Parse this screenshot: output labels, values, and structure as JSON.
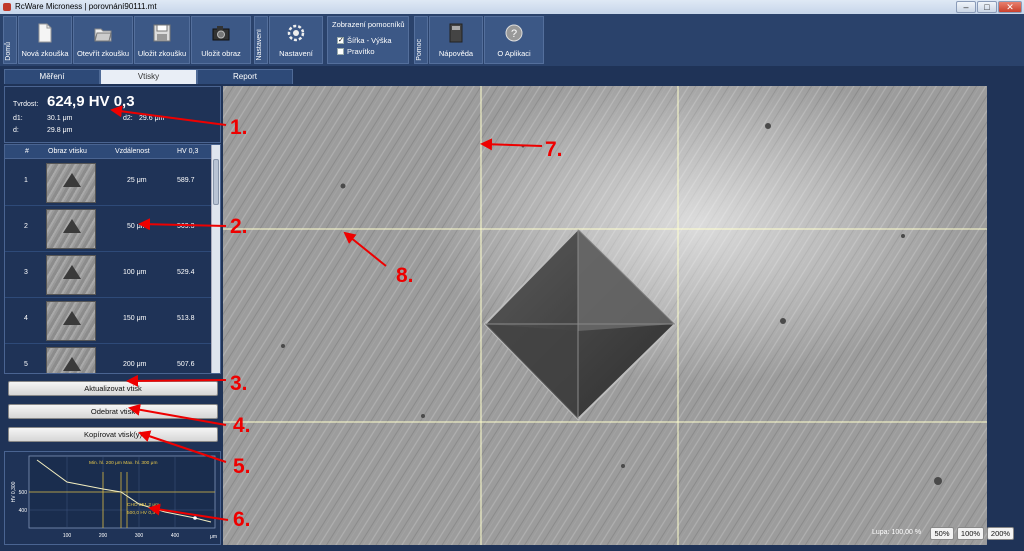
{
  "window": {
    "title": "RcWare Microness | porovnání90111.mt",
    "min": "–",
    "max": "□",
    "close": "✕"
  },
  "ribbon": {
    "group_home": "Domů",
    "new_test": "Nová zkouška",
    "open_test": "Otevřít zkoušku",
    "save_test": "Uložit zkoušku",
    "save_image": "Uložit obraz",
    "group_settings": "Nastavení",
    "settings": "Nastavení",
    "helper_title": "Zobrazení pomocníků",
    "width_height": "Šířka - Výška",
    "ruler": "Pravítko",
    "group_help": "Pomoc",
    "help": "Nápověda",
    "about": "O Aplikaci"
  },
  "tabs": [
    "Měření",
    "Vtisky",
    "Report"
  ],
  "info": {
    "hardness_label": "Tvrdost:",
    "hardness_value": "624,9 HV 0,3",
    "d1_label": "d1:",
    "d1_value": "30.1 μm",
    "d2_label": "d2:",
    "d2_value": "29.6 μm",
    "d_label": "d:",
    "d_value": "29.8 μm"
  },
  "table": {
    "columns": [
      "#",
      "Obraz vtisku",
      "Vzdálenost",
      "HV 0,3"
    ],
    "rows": [
      {
        "num": "1",
        "distance": "25  μm",
        "hv": "589.7"
      },
      {
        "num": "2",
        "distance": "50  μm",
        "hv": "569.3"
      },
      {
        "num": "3",
        "distance": "100  μm",
        "hv": "529.4"
      },
      {
        "num": "4",
        "distance": "150  μm",
        "hv": "513.8"
      },
      {
        "num": "5",
        "distance": "200  μm",
        "hv": "507.6"
      }
    ]
  },
  "actions": {
    "update": "Aktualizovat vtisk",
    "remove": "Odebrat vtisk",
    "copy": "Kopírovat vtisk(y)"
  },
  "chart": {
    "ylabel": "HV 0,300",
    "xunit": "μm",
    "yticks": [
      "500",
      "400"
    ],
    "xticks": [
      "100",
      "200",
      "300",
      "400"
    ],
    "annot_limits": "Min. hl. 200 μm  Max. hl. 300 μm",
    "annot_cho": "CHO 251,2 μm",
    "annot_hv": "500,0 HV 0,3"
  },
  "viewer": {
    "zoom_label": "Lupa: 100,00 %",
    "zoom_50": "50%",
    "zoom_100": "100%",
    "zoom_200": "200%"
  },
  "annotations": [
    "1.",
    "2.",
    "3.",
    "4.",
    "5.",
    "6.",
    "7.",
    "8."
  ],
  "colors": {
    "background": "#1f3357",
    "ribbon": "#2a426b",
    "annotation": "#e00000",
    "guideline": "#ffffcc"
  }
}
